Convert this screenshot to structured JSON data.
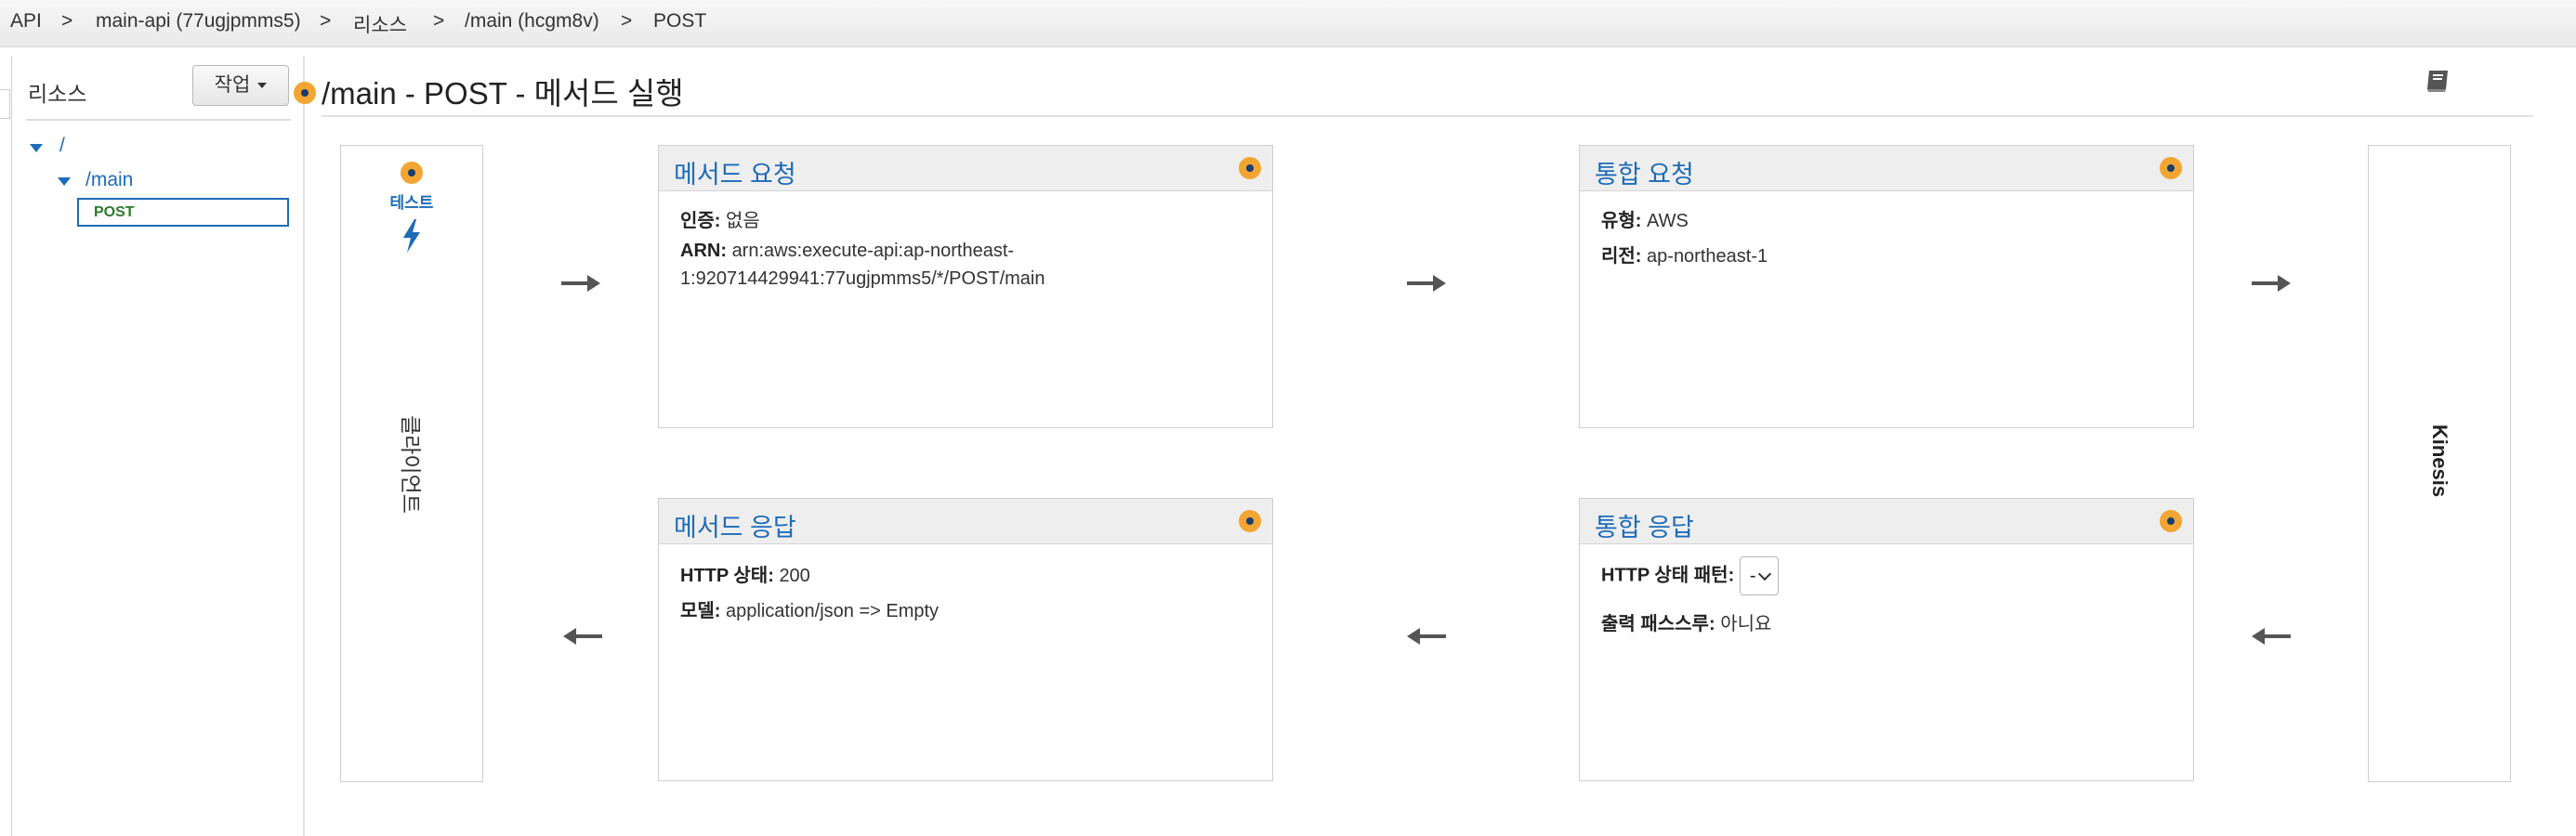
{
  "breadcrumb": {
    "items": [
      "API",
      "main-api (77ugjpmms5)",
      "리소스",
      "/main (hcgm8v)",
      "POST"
    ],
    "separator": ">"
  },
  "sidebar": {
    "title": "리소스",
    "action_button": "작업",
    "tree": [
      {
        "label": "/",
        "expanded": true
      },
      {
        "label": "/main",
        "expanded": true
      },
      {
        "label": "POST",
        "selected": true
      }
    ]
  },
  "page": {
    "title": "/main - POST - 메서드 실행"
  },
  "client": {
    "test_label": "테스트",
    "label": "클라이언트"
  },
  "method_request": {
    "title": "메서드 요청",
    "auth_label": "인증:",
    "auth_value": "없음",
    "arn_label": "ARN:",
    "arn_value_line1": "arn:aws:execute-api:ap-northeast-",
    "arn_value_line2": "1:920714429941:77ugjpmms5/*/POST/main"
  },
  "integration_request": {
    "title": "통합 요청",
    "type_label": "유형:",
    "type_value": "AWS",
    "region_label": "리전:",
    "region_value": "ap-northeast-1"
  },
  "method_response": {
    "title": "메서드 응답",
    "status_label": "HTTP 상태:",
    "status_value": "200",
    "model_label": "모델:",
    "model_value": "application/json => Empty"
  },
  "integration_response": {
    "title": "통합 응답",
    "pattern_label": "HTTP 상태 패턴:",
    "pattern_value": "-",
    "passthrough_label": "출력 패스스루:",
    "passthrough_value": "아니요"
  },
  "backend": {
    "label": "Kinesis"
  },
  "colors": {
    "accent_blue": "#1e6bb8",
    "orange": "#f3a533",
    "selected_green": "#2d7a2d"
  }
}
